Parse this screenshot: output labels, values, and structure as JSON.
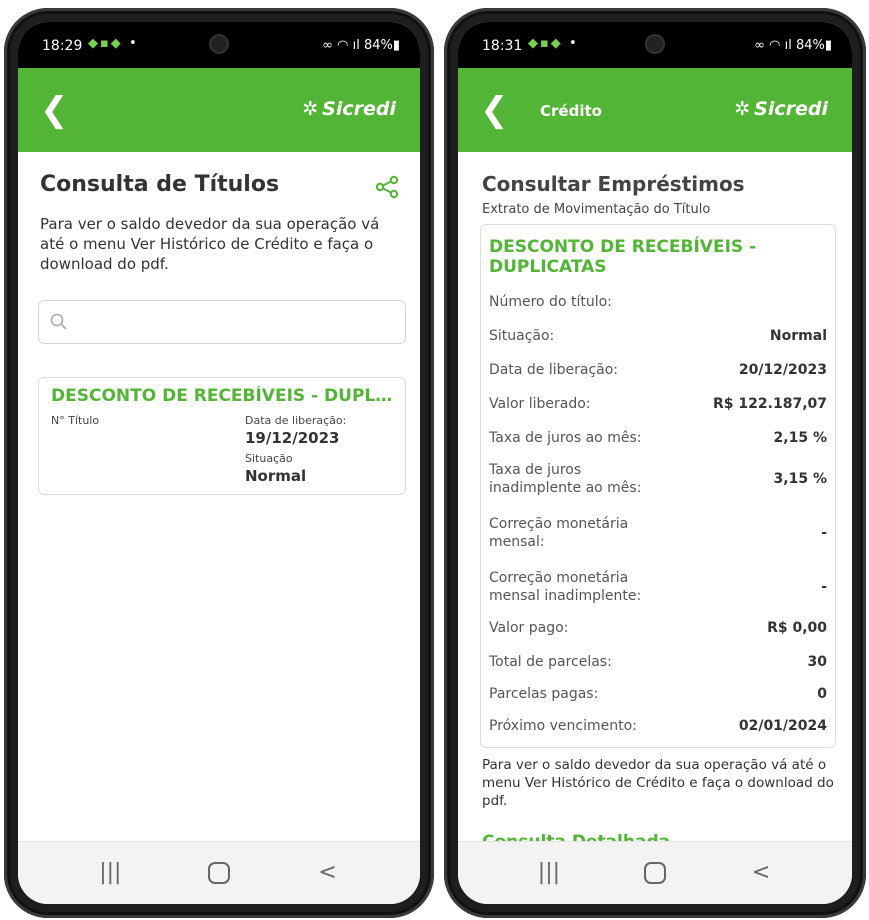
{
  "left": {
    "status": {
      "time": "18:29",
      "battery": "84%"
    },
    "appbar": {
      "brand": "Sicredi"
    },
    "page_title": "Consulta de Títulos",
    "info_text": "Para ver o saldo devedor da sua operação vá até o menu  Ver Histórico de Crédito e faça o download do pdf.",
    "search": {
      "placeholder": "",
      "value": ""
    },
    "card": {
      "title": "DESCONTO DE RECEBÍVEIS - DUPLICATAS",
      "num_label": "N° Título",
      "release_label": "Data de liberação:",
      "release_value": "19/12/2023",
      "status_label": "Situação",
      "status_value": "Normal"
    }
  },
  "right": {
    "status": {
      "time": "18:31",
      "battery": "84%"
    },
    "appbar": {
      "title": "Crédito",
      "brand": "Sicredi"
    },
    "page_title": "Consultar Empréstimos",
    "subtitle": "Extrato de Movimentação do Título",
    "card_title_line1": "DESCONTO DE RECEBÍVEIS -",
    "card_title_line2": "DUPLICATAS",
    "rows": [
      {
        "label": "Número do título:",
        "value": ""
      },
      {
        "label": "Situação:",
        "value": "Normal"
      },
      {
        "label": "Data de liberação:",
        "value": "20/12/2023"
      },
      {
        "label": "Valor liberado:",
        "value": "R$ 122.187,07"
      },
      {
        "label": "Taxa de juros ao mês:",
        "value": "2,15 %"
      },
      {
        "label": "Taxa de juros",
        "label2": "inadimplente ao mês:",
        "value": "3,15 %"
      },
      {
        "label": "Correção monetária",
        "label2": "mensal:",
        "value": "-"
      },
      {
        "label": "Correção monetária",
        "label2": "mensal inadimplente:",
        "value": "-"
      },
      {
        "label": "Valor pago:",
        "value": "R$ 0,00"
      },
      {
        "label": "Total de parcelas:",
        "value": "30"
      },
      {
        "label": "Parcelas pagas:",
        "value": "0"
      },
      {
        "label": "Próximo vencimento:",
        "value": "02/01/2024"
      }
    ],
    "info_text": "Para ver o saldo devedor da sua operação vá até o menu  Ver Histórico de Crédito e faça o download do pdf.",
    "detail_link": "Consulta Detalhada"
  },
  "colors": {
    "brand_green": "#53b535",
    "status_bar": "#000000"
  },
  "icons": [
    "back-arrow-icon",
    "sicredi-logo-icon",
    "share-icon",
    "search-icon",
    "recent-apps-icon",
    "home-icon",
    "nav-back-icon"
  ]
}
